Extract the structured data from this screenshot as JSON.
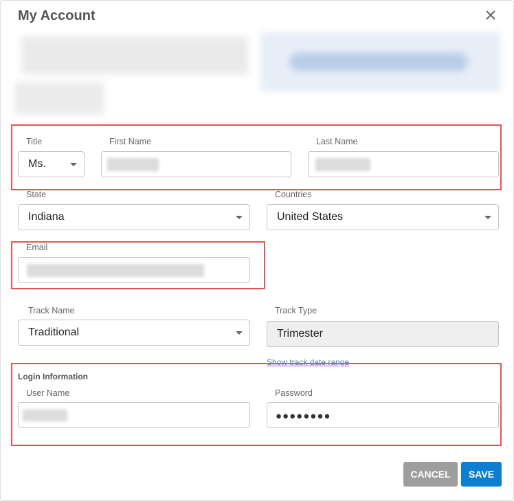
{
  "dialog": {
    "title": "My Account"
  },
  "form": {
    "title": {
      "label": "Title",
      "value": "Ms."
    },
    "first_name": {
      "label": "First Name"
    },
    "last_name": {
      "label": "Last Name"
    },
    "state": {
      "label": "State",
      "value": "Indiana"
    },
    "countries": {
      "label": "Countries",
      "value": "United States"
    },
    "email": {
      "label": "Email"
    },
    "track_name": {
      "label": "Track Name",
      "value": "Traditional"
    },
    "track_type": {
      "label": "Track Type",
      "value": "Trimester"
    },
    "track_link": "Show track date range",
    "login": {
      "section_title": "Login Information",
      "username": {
        "label": "User Name"
      },
      "password": {
        "label": "Password",
        "value": "●●●●●●●●"
      }
    }
  },
  "actions": {
    "cancel": "CANCEL",
    "save": "SAVE"
  },
  "colors": {
    "primary": "#0e7fd0",
    "cancel": "#9e9e9e",
    "highlight": "#e25555"
  }
}
